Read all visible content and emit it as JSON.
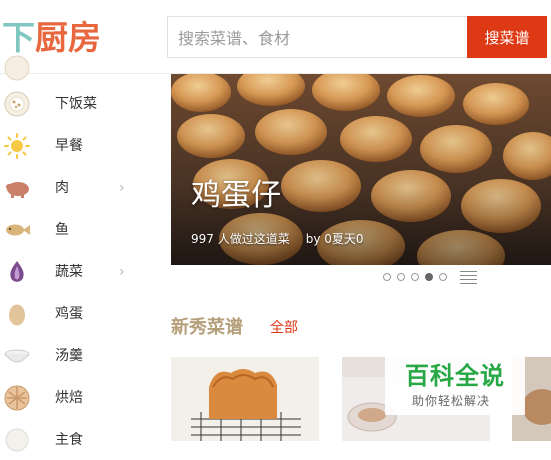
{
  "header": {
    "logo": [
      "下",
      "厨",
      "房"
    ],
    "search_placeholder": "搜索菜谱、食材",
    "search_button": "搜菜谱"
  },
  "sidebar": {
    "items": [
      {
        "label": "下饭菜",
        "icon": "rice-bowl-icon",
        "has_arrow": false
      },
      {
        "label": "早餐",
        "icon": "sun-icon",
        "has_arrow": false
      },
      {
        "label": "肉",
        "icon": "pig-icon",
        "has_arrow": true,
        "arrow": "›"
      },
      {
        "label": "鱼",
        "icon": "fish-icon",
        "has_arrow": false
      },
      {
        "label": "蔬菜",
        "icon": "onion-icon",
        "has_arrow": true,
        "arrow": "›"
      },
      {
        "label": "鸡蛋",
        "icon": "egg-icon",
        "has_arrow": false
      },
      {
        "label": "汤羹",
        "icon": "soup-bowl-icon",
        "has_arrow": false
      },
      {
        "label": "烘焙",
        "icon": "pie-icon",
        "has_arrow": false
      },
      {
        "label": "主食",
        "icon": "staple-icon",
        "has_arrow": false
      }
    ]
  },
  "banner": {
    "title": "鸡蛋仔",
    "count_text": "997 人做过这道菜",
    "author_text": "by 0夏天0",
    "slides": 5,
    "active_slide": 4
  },
  "section": {
    "title": "新秀菜谱",
    "all_link": "全部"
  },
  "watermark": {
    "title": "百科全说",
    "subtitle": "助你轻松解决"
  },
  "colors": {
    "accent": "#dd3915",
    "logo_teal": "#7fc7c0",
    "logo_orange": "#e9673f",
    "section_title": "#b59f7a"
  }
}
